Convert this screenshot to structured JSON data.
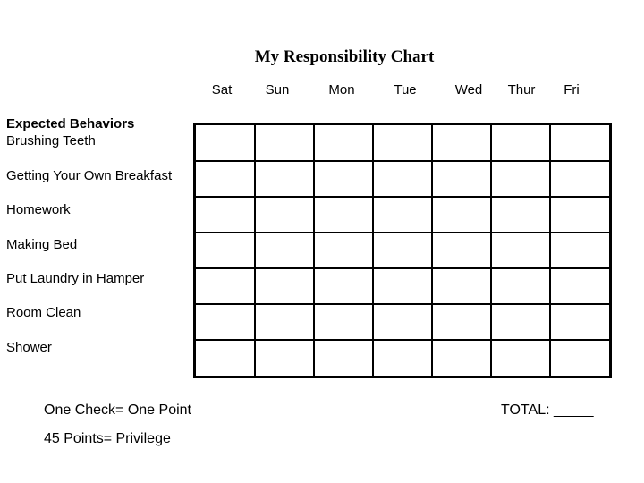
{
  "title": "My Responsibility Chart",
  "days": [
    "Sat",
    "Sun",
    "Mon",
    "Tue",
    "Wed",
    "Thur",
    "Fri"
  ],
  "heading": "Expected Behaviors",
  "behaviors": [
    "Brushing Teeth",
    "Getting Your Own Breakfast",
    "Homework",
    "Making Bed",
    "Put Laundry in Hamper",
    "Room Clean",
    "Shower"
  ],
  "footer": {
    "rule_one": "One Check= One Point",
    "rule_two": "45 Points= Privilege",
    "total_label": "TOTAL: _____"
  }
}
